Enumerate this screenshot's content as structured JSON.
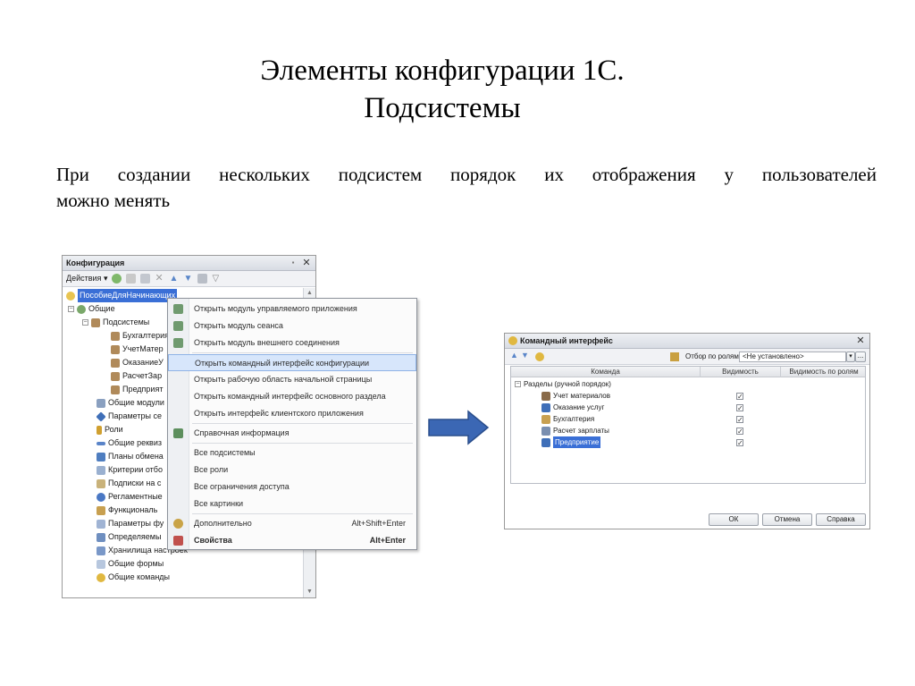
{
  "slide": {
    "title_line1": "Элементы конфигурации 1С.",
    "title_line2": "Подсистемы",
    "body_line1": "При создании нескольких подсистем порядок их отображения у пользователей",
    "body_line2": "можно менять"
  },
  "config_window": {
    "title": "Конфигурация",
    "actions_label": "Действия",
    "tree": {
      "root": "ПособиеДляНачинающих",
      "common": "Общие",
      "subsystems": "Подсистемы",
      "subsystem_items": [
        "Бухгалтерия",
        "УчетМатер",
        "ОказаниеУ",
        "РасчетЗар",
        "Предприят"
      ],
      "items": [
        "Общие модули",
        "Параметры се",
        "Роли",
        "Общие реквиз",
        "Планы обмена",
        "Критерии отбо",
        "Подписки на с",
        "Регламентные",
        "Функциональ",
        "Параметры фу",
        "Определяемы",
        "Хранилища настроек",
        "Общие формы",
        "Общие команды"
      ]
    }
  },
  "context_menu": {
    "items": [
      {
        "label": "Открыть модуль управляемого приложения",
        "shortcut": ""
      },
      {
        "label": "Открыть модуль сеанса",
        "shortcut": ""
      },
      {
        "label": "Открыть модуль внешнего соединения",
        "shortcut": ""
      },
      {
        "label": "Открыть командный интерфейс конфигурации",
        "shortcut": ""
      },
      {
        "label": "Открыть рабочую область начальной страницы",
        "shortcut": ""
      },
      {
        "label": "Открыть командный интерфейс основного раздела",
        "shortcut": ""
      },
      {
        "label": "Открыть интерфейс клиентского приложения",
        "shortcut": ""
      },
      {
        "label": "Справочная информация",
        "shortcut": ""
      },
      {
        "label": "Все подсистемы",
        "shortcut": ""
      },
      {
        "label": "Все роли",
        "shortcut": ""
      },
      {
        "label": "Все ограничения доступа",
        "shortcut": ""
      },
      {
        "label": "Все картинки",
        "shortcut": ""
      },
      {
        "label": "Дополнительно",
        "shortcut": "Alt+Shift+Enter"
      },
      {
        "label": "Свойства",
        "shortcut": "Alt+Enter"
      }
    ]
  },
  "cmd_window": {
    "title": "Командный интерфейс",
    "filter_label": "Отбор по ролям:",
    "filter_value": "<Не установлено>",
    "columns": [
      "Команда",
      "Видимость",
      "Видимость по ролям"
    ],
    "group": "Разделы (ручной порядок)",
    "rows": [
      {
        "name": "Учет материалов",
        "visible": "✓"
      },
      {
        "name": "Оказание услуг",
        "visible": "✓"
      },
      {
        "name": "Бухгалтерия",
        "visible": "✓"
      },
      {
        "name": "Расчет зарплаты",
        "visible": "✓"
      },
      {
        "name": "Предприятие",
        "visible": "✓"
      }
    ],
    "buttons": {
      "ok": "ОК",
      "cancel": "Отмена",
      "help": "Справка"
    }
  },
  "colors": {
    "selection": "#3a6fd6",
    "arrow": "#3b67b4",
    "menu_highlight": "#d7e6fb"
  }
}
